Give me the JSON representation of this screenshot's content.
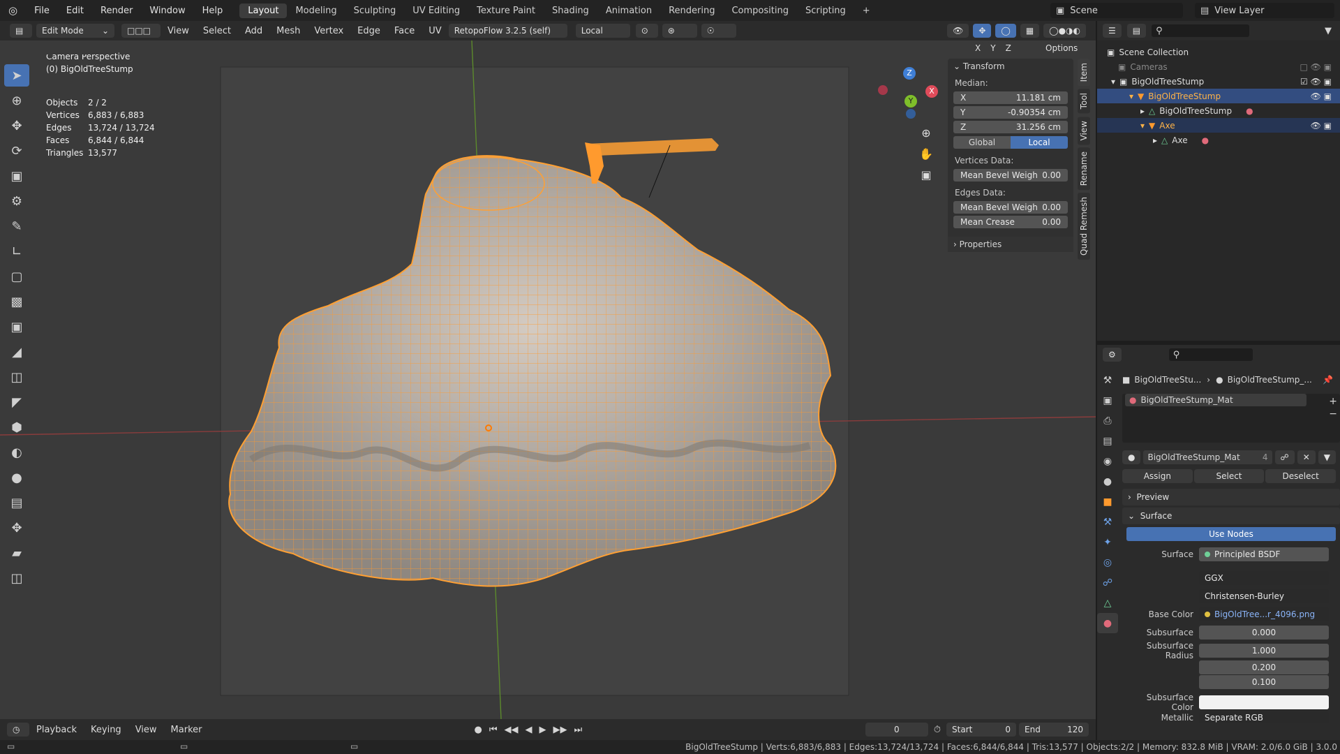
{
  "topbar": {
    "menus": [
      "File",
      "Edit",
      "Render",
      "Window",
      "Help"
    ],
    "workspaces": [
      "Layout",
      "Modeling",
      "Sculpting",
      "UV Editing",
      "Texture Paint",
      "Shading",
      "Animation",
      "Rendering",
      "Compositing",
      "Scripting"
    ],
    "active_workspace": "Layout",
    "plus": "+",
    "scene": "Scene",
    "view_layer": "View Layer"
  },
  "header": {
    "mode": "Edit Mode",
    "menus": [
      "View",
      "Select",
      "Add",
      "Mesh",
      "Vertex",
      "Edge",
      "Face",
      "UV"
    ],
    "addon": "RetopoFlow 3.2.5 (self)",
    "orientation": "Local",
    "options": "Options",
    "axes": [
      "X",
      "Y",
      "Z"
    ]
  },
  "viewport": {
    "title": "Camera Perspective",
    "object": "(0) BigOldTreeStump",
    "stats": [
      {
        "k": "Objects",
        "v": "2 / 2"
      },
      {
        "k": "Vertices",
        "v": "6,883 / 6,883"
      },
      {
        "k": "Edges",
        "v": "13,724 / 13,724"
      },
      {
        "k": "Faces",
        "v": "6,844 / 6,844"
      },
      {
        "k": "Triangles",
        "v": "13,577"
      }
    ],
    "gizmo": {
      "z": "Z",
      "y": "Y",
      "x": "X"
    }
  },
  "npanel": {
    "transform": "Transform",
    "median": "Median:",
    "x_label": "X",
    "x": "11.181 cm",
    "y_label": "Y",
    "y": "-0.90354 cm",
    "z_label": "Z",
    "z": "31.256 cm",
    "global": "Global",
    "local": "Local",
    "vertices_data": "Vertices Data:",
    "mean_bevel_v": "Mean Bevel Weigh",
    "mean_bevel_v_val": "0.00",
    "edges_data": "Edges Data:",
    "mean_bevel_e": "Mean Bevel Weigh",
    "mean_bevel_e_val": "0.00",
    "mean_crease": "Mean Crease",
    "mean_crease_val": "0.00",
    "properties": "Properties",
    "tabs": [
      "Item",
      "Tool",
      "View",
      "Rename",
      "Quad Remesh"
    ]
  },
  "outliner": {
    "rows": [
      {
        "label": "Scene Collection"
      },
      {
        "label": "Cameras"
      },
      {
        "label": "BigOldTreeStump"
      },
      {
        "label": "BigOldTreeStump"
      },
      {
        "label": "BigOldTreeStump"
      },
      {
        "label": "Axe"
      },
      {
        "label": "Axe"
      }
    ]
  },
  "props": {
    "breadcrumb1": "BigOldTreeStu...",
    "breadcrumb2": "BigOldTreeStump_...",
    "slot": "BigOldTreeStump_Mat",
    "material": "BigOldTreeStump_Mat",
    "users": "4",
    "assign": "Assign",
    "select": "Select",
    "deselect": "Deselect",
    "preview": "Preview",
    "surface_section": "Surface",
    "use_nodes": "Use Nodes",
    "surface_k": "Surface",
    "surface_v": "Principled BSDF",
    "ggx": "GGX",
    "burley": "Christensen-Burley",
    "base_color_k": "Base Color",
    "base_color_v": "BigOldTree...r_4096.png",
    "subsurface_k": "Subsurface",
    "subsurface_v": "0.000",
    "radius_k": "Subsurface Radius",
    "r1": "1.000",
    "r2": "0.200",
    "r3": "0.100",
    "ss_color_k": "Subsurface Color",
    "metallic_k": "Metallic",
    "metallic_v": "Separate RGB"
  },
  "timeline": {
    "menus": [
      "Playback",
      "Keying",
      "View",
      "Marker"
    ],
    "frame": "0",
    "start_k": "Start",
    "start": "0",
    "end_k": "End",
    "end": "120"
  },
  "status": "BigOldTreeStump | Verts:6,883/6,883 | Edges:13,724/13,724 | Faces:6,844/6,844 | Tris:13,577 | Objects:2/2 | Memory: 832.8 MiB | VRAM: 2.0/6.0 GiB | 3.0.0",
  "colors": {
    "accent": "#4772b3",
    "selection": "#ffa033",
    "mesh": "#b8b2ac"
  }
}
